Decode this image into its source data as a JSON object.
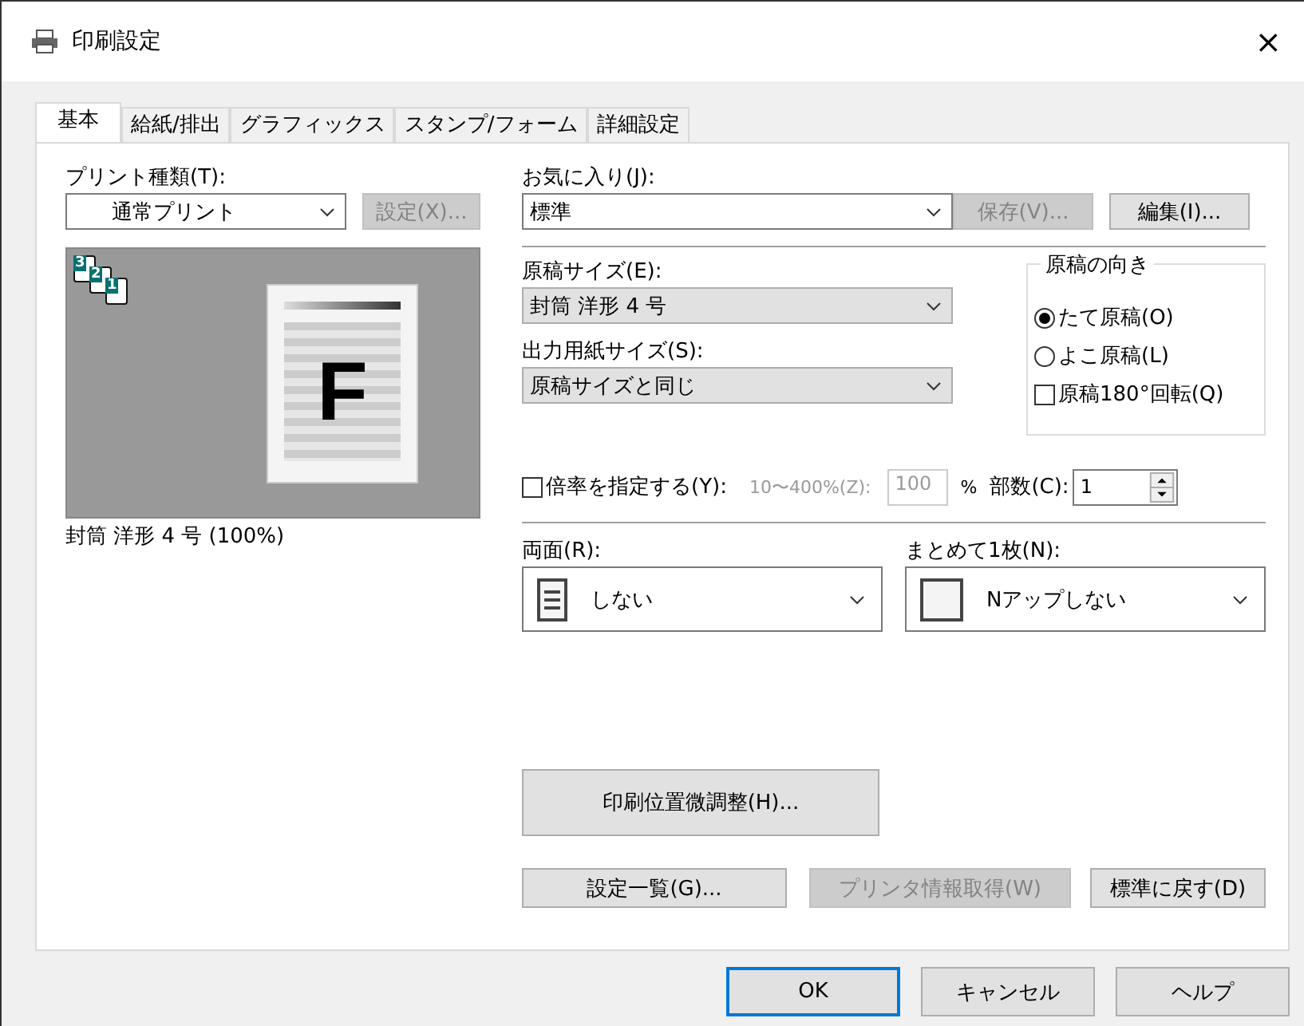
{
  "window": {
    "title": "印刷設定",
    "close": "×"
  },
  "tabs": [
    {
      "label": "基本",
      "selected": true
    },
    {
      "label": "給紙/排出",
      "selected": false
    },
    {
      "label": "グラフィックス",
      "selected": false
    },
    {
      "label": "スタンプ/フォーム",
      "selected": false
    },
    {
      "label": "詳細設定",
      "selected": false
    }
  ],
  "print_type": {
    "label": "プリント種類(T):",
    "value": "通常プリント",
    "button": {
      "label": "設定(X)...",
      "disabled": true
    }
  },
  "preview": {
    "letter": "F",
    "collate_numbers": [
      "3",
      "2",
      "1"
    ],
    "caption": "封筒 洋形 4 号 (100%)"
  },
  "favorites": {
    "label": "お気に入り(J):",
    "value": "標準",
    "buttons": [
      {
        "label": "保存(V)...",
        "disabled": true
      },
      {
        "label": "編集(I)...",
        "disabled": false
      }
    ]
  },
  "original_size": {
    "label": "原稿サイズ(E):",
    "value": "封筒 洋形 4 号"
  },
  "output_size": {
    "label": "出力用紙サイズ(S):",
    "value": "原稿サイズと同じ"
  },
  "orientation": {
    "title": "原稿の向き",
    "options": [
      {
        "label": "たて原稿(O)",
        "selected": true
      },
      {
        "label": "よこ原稿(L)",
        "selected": false
      }
    ],
    "rotate": {
      "label": "原稿180°回転(Q)",
      "checked": false
    }
  },
  "zoom": {
    "label": "倍率を指定する(Y):",
    "checked": false,
    "range_label": "10〜400%(Z):",
    "value": "100",
    "unit": "%"
  },
  "copies": {
    "label": "部数(C):",
    "value": "1"
  },
  "duplex": {
    "label": "両面(R):",
    "value": "しない"
  },
  "nup": {
    "label": "まとめて1枚(N):",
    "value": "Nアップしない"
  },
  "adjust_button": "印刷位置微調整(H)...",
  "bottom_buttons": [
    {
      "label": "設定一覧(G)...",
      "disabled": false
    },
    {
      "label": "プリンタ情報取得(W)",
      "disabled": true
    },
    {
      "label": "標準に戻す(D)",
      "disabled": false
    }
  ],
  "dialog_buttons": [
    {
      "label": "OK",
      "default": true
    },
    {
      "label": "キャンセル",
      "default": false
    },
    {
      "label": "ヘルプ",
      "default": false
    }
  ]
}
